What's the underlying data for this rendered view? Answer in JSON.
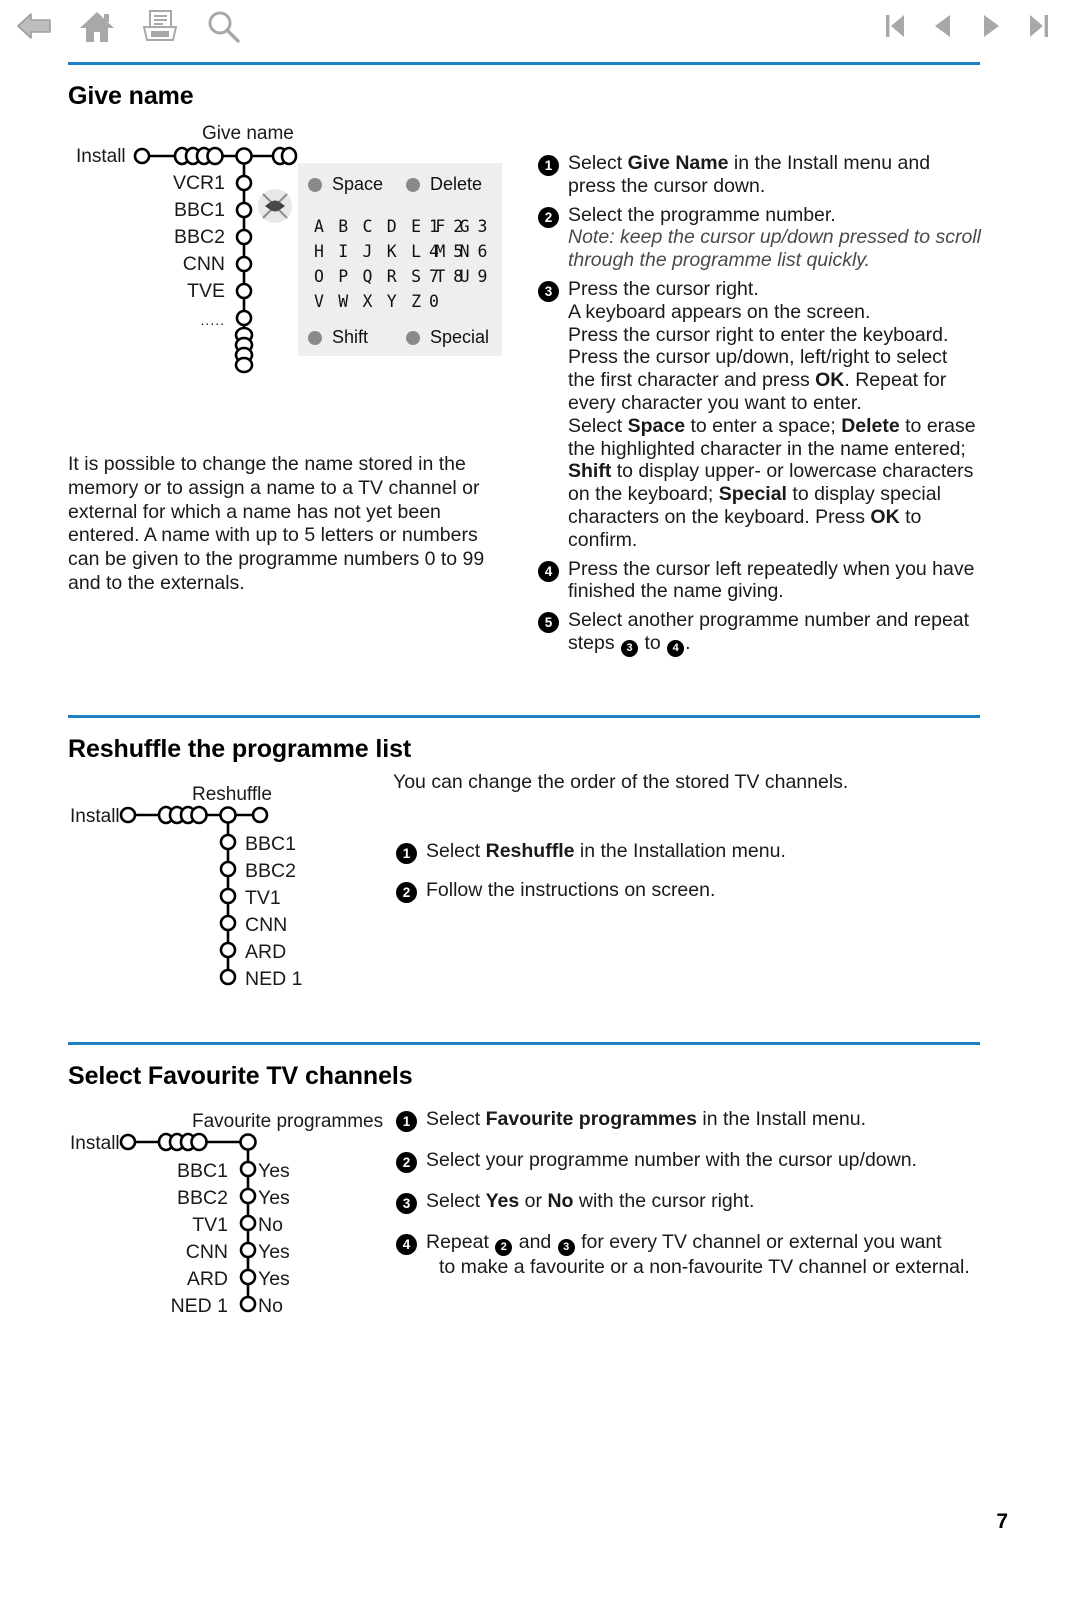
{
  "toolbar": {
    "left_icons": [
      {
        "name": "back-arrow-icon",
        "label": "Back"
      },
      {
        "name": "home-icon",
        "label": "Home"
      },
      {
        "name": "print-icon",
        "label": "Print"
      },
      {
        "name": "search-icon",
        "label": "Search"
      }
    ],
    "right_icons": [
      {
        "name": "first-page-icon",
        "label": "First page"
      },
      {
        "name": "previous-page-icon",
        "label": "Previous page"
      },
      {
        "name": "next-page-icon",
        "label": "Next page"
      },
      {
        "name": "last-page-icon",
        "label": "Last page"
      }
    ],
    "accent_color": "#1f7fc4",
    "icon_color": "#a6a6a6"
  },
  "page": {
    "number": "7"
  },
  "sections": {
    "give_name": {
      "title": "Give name",
      "diagram": {
        "root_label": "Install",
        "menu_label": "Give name",
        "items": [
          "VCR1",
          "BBC1",
          "BBC2",
          "CNN",
          "TVE",
          "....."
        ],
        "keyboard": {
          "space_label": "Space",
          "delete_label": "Delete",
          "shift_label": "Shift",
          "special_label": "Special",
          "letter_rows": [
            "A B C D E F G",
            "H I J K L M N",
            "O P Q R S T U",
            "V W X Y Z"
          ],
          "number_rows": [
            "1 2 3",
            "4 5 6",
            "7 8 9",
            "0"
          ]
        }
      },
      "paragraph": "It is possible to change the name stored in the memory or to assign a name to a TV channel or external for which a name has not yet been entered. A name with up to 5 letters or numbers can be given to the programme numbers 0 to 99 and to the externals.",
      "steps": [
        {
          "num": "1",
          "lines": [
            {
              "parts": [
                {
                  "t": "Select ",
                  "b": false
                },
                {
                  "t": "Give Name",
                  "b": true
                },
                {
                  "t": " in the Install menu and",
                  "b": false
                }
              ]
            },
            {
              "parts": [
                {
                  "t": "press the cursor down.",
                  "b": false
                }
              ]
            }
          ]
        },
        {
          "num": "2",
          "lines": [
            {
              "parts": [
                {
                  "t": "Select the programme number.",
                  "b": false
                }
              ]
            },
            {
              "italic": true,
              "parts": [
                {
                  "t": "Note: keep the cursor up/down pressed to scroll",
                  "b": false
                }
              ]
            },
            {
              "italic": true,
              "parts": [
                {
                  "t": "through the programme list quickly.",
                  "b": false
                }
              ]
            }
          ]
        },
        {
          "num": "3",
          "lines": [
            {
              "parts": [
                {
                  "t": "Press the cursor right.",
                  "b": false
                }
              ]
            },
            {
              "parts": [
                {
                  "t": "A keyboard appears on the screen.",
                  "b": false
                }
              ]
            },
            {
              "parts": [
                {
                  "t": "Press the cursor right to enter the keyboard.",
                  "b": false
                }
              ]
            },
            {
              "parts": [
                {
                  "t": "Press the cursor up/down, left/right to select",
                  "b": false
                }
              ]
            },
            {
              "parts": [
                {
                  "t": "the first character and press ",
                  "b": false
                },
                {
                  "t": "OK",
                  "b": true
                },
                {
                  "t": ". Repeat for",
                  "b": false
                }
              ]
            },
            {
              "parts": [
                {
                  "t": "every character you want to enter.",
                  "b": false
                }
              ]
            },
            {
              "parts": [
                {
                  "t": "Select ",
                  "b": false
                },
                {
                  "t": "Space",
                  "b": true
                },
                {
                  "t": " to enter a space; ",
                  "b": false
                },
                {
                  "t": "Delete",
                  "b": true
                },
                {
                  "t": " to erase",
                  "b": false
                }
              ]
            },
            {
              "parts": [
                {
                  "t": "the highlighted character in the name entered;",
                  "b": false
                }
              ]
            },
            {
              "parts": [
                {
                  "t": "Shift",
                  "b": true
                },
                {
                  "t": " to display upper- or lowercase characters",
                  "b": false
                }
              ]
            },
            {
              "parts": [
                {
                  "t": "on the keyboard; ",
                  "b": false
                },
                {
                  "t": "Special",
                  "b": true
                },
                {
                  "t": " to display special",
                  "b": false
                }
              ]
            },
            {
              "parts": [
                {
                  "t": "characters on the keyboard. Press ",
                  "b": false
                },
                {
                  "t": "OK",
                  "b": true
                },
                {
                  "t": " to",
                  "b": false
                }
              ]
            },
            {
              "parts": [
                {
                  "t": "confirm.",
                  "b": false
                }
              ]
            }
          ]
        },
        {
          "num": "4",
          "lines": [
            {
              "parts": [
                {
                  "t": "Press the cursor left repeatedly when you have",
                  "b": false
                }
              ]
            },
            {
              "parts": [
                {
                  "t": "finished the name giving.",
                  "b": false
                }
              ]
            }
          ]
        },
        {
          "num": "5",
          "lines": [
            {
              "parts": [
                {
                  "t": "Select another programme number and repeat",
                  "b": false
                }
              ]
            },
            {
              "parts": [
                {
                  "t": "steps ",
                  "b": false
                },
                {
                  "n": "3"
                },
                {
                  "t": " to ",
                  "b": false
                },
                {
                  "n": "4"
                },
                {
                  "t": ".",
                  "b": false
                }
              ]
            }
          ]
        }
      ]
    },
    "reshuffle": {
      "title": "Reshuffle the programme list",
      "intro": "You can change the order of the stored TV channels.",
      "diagram": {
        "root_label": "Install",
        "menu_label": "Reshuffle",
        "items": [
          "BBC1",
          "BBC2",
          "TV1",
          "CNN",
          "ARD",
          "NED 1"
        ]
      },
      "steps": [
        {
          "num": "1",
          "lines": [
            {
              "parts": [
                {
                  "t": "Select ",
                  "b": false
                },
                {
                  "t": "Reshuffle",
                  "b": true
                },
                {
                  "t": " in the Installation menu.",
                  "b": false
                }
              ]
            }
          ]
        },
        {
          "num": "2",
          "lines": [
            {
              "parts": [
                {
                  "t": "Follow the instructions on screen.",
                  "b": false
                }
              ]
            }
          ]
        }
      ]
    },
    "favourite": {
      "title": "Select Favourite TV channels",
      "diagram": {
        "root_label": "Install",
        "menu_label": "Favourite programmes",
        "rows": [
          {
            "name": "BBC1",
            "value": "Yes"
          },
          {
            "name": "BBC2",
            "value": "Yes"
          },
          {
            "name": "TV1",
            "value": "No"
          },
          {
            "name": "CNN",
            "value": "Yes"
          },
          {
            "name": "ARD",
            "value": "Yes"
          },
          {
            "name": "NED 1",
            "value": "No"
          }
        ]
      },
      "steps": [
        {
          "num": "1",
          "lines": [
            {
              "parts": [
                {
                  "t": "Select ",
                  "b": false
                },
                {
                  "t": "Favourite programmes",
                  "b": true
                },
                {
                  "t": " in the Install menu.",
                  "b": false
                }
              ]
            }
          ]
        },
        {
          "num": "2",
          "lines": [
            {
              "parts": [
                {
                  "t": "Select your programme number with the cursor up/down.",
                  "b": false
                }
              ]
            }
          ]
        },
        {
          "num": "3",
          "lines": [
            {
              "parts": [
                {
                  "t": "Select ",
                  "b": false
                },
                {
                  "t": "Yes",
                  "b": true
                },
                {
                  "t": " or ",
                  "b": false
                },
                {
                  "t": "No",
                  "b": true
                },
                {
                  "t": " with the cursor right.",
                  "b": false
                }
              ]
            }
          ]
        },
        {
          "num": "4",
          "lines": [
            {
              "parts": [
                {
                  "t": "Repeat ",
                  "b": false
                },
                {
                  "n": "2"
                },
                {
                  "t": " and ",
                  "b": false
                },
                {
                  "n": "3"
                },
                {
                  "t": " for every TV channel or external you want",
                  "b": false
                }
              ]
            },
            {
              "indent": true,
              "parts": [
                {
                  "t": "to make a favourite or a non-favourite TV channel or external.",
                  "b": false
                }
              ]
            }
          ]
        }
      ]
    }
  }
}
